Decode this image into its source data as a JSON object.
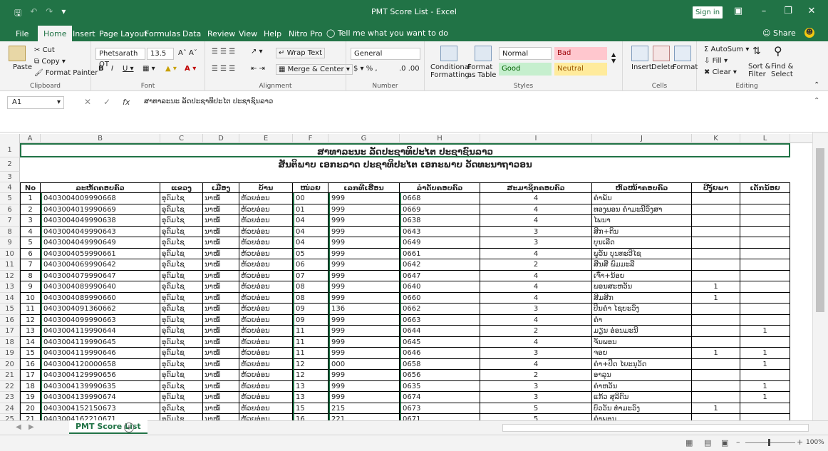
{
  "app": {
    "title": "PMT Score List  -  Excel",
    "signin": "Sign in",
    "share": "Share",
    "tell_me": "Tell me what you want to do"
  },
  "tabs": [
    "File",
    "Home",
    "Insert",
    "Page Layout",
    "Formulas",
    "Data",
    "Review",
    "View",
    "Help",
    "Nitro Pro"
  ],
  "ribbon": {
    "clipboard": {
      "paste": "Paste",
      "cut": "Cut",
      "copy": "Copy",
      "format_painter": "Format Painter",
      "label": "Clipboard"
    },
    "font": {
      "name": "Phetsarath OT",
      "size": "13.5",
      "label": "Font"
    },
    "alignment": {
      "wrap": "Wrap Text",
      "merge": "Merge & Center",
      "label": "Alignment"
    },
    "number": {
      "format": "General",
      "label": "Number"
    },
    "styles": {
      "conditional": "Conditional Formatting",
      "format_table": "Format as Table",
      "normal": "Normal",
      "bad": "Bad",
      "good": "Good",
      "neutral": "Neutral",
      "label": "Styles"
    },
    "cells": {
      "insert": "Insert",
      "delete": "Delete",
      "format": "Format",
      "label": "Cells"
    },
    "editing": {
      "autosum": "AutoSum",
      "fill": "Fill",
      "clear": "Clear",
      "sort": "Sort & Filter",
      "find": "Find & Select",
      "label": "Editing"
    }
  },
  "formula_bar": {
    "name_box": "A1",
    "fx": "fx",
    "value": "ສາທາລະນະ ລັດປະຊາທິປະໄຕ ປະຊາຊົນລາວ"
  },
  "columns": [
    "A",
    "B",
    "C",
    "D",
    "E",
    "F",
    "G",
    "H",
    "I",
    "J",
    "K",
    "L"
  ],
  "sheet": {
    "title1": "ສາທາລະນະ ລັດປະຊາທິປະໄຕ ປະຊາຊົນລາວ",
    "title2": "ສັນຕິພາບ ເອກະລາດ ປະຊາທິປະໄຕ ເອກະພາບ ວັດທະນາຖາວອນ",
    "headers": [
      "No",
      "ລະຫັດຄອບຄົວ",
      "ແຂວງ",
      "ເມືອງ",
      "ບ້ານ",
      "ໜ່ວຍ",
      "ເລກທີເຮືອນ",
      "ລຳດັບຄອບຄົວ",
      "ສະມາຊິກຄອບຄົວ",
      "ຫົວໜ້າຄອບຄົວ",
      "ປີງຸ້ຍພາ",
      "ເດັກນ້ອຍ"
    ],
    "rows": [
      [
        "1",
        "0403004009990668",
        "ອຸດົມໄຊ",
        "ນາໝໍ້",
        "ຫ້ວຍອ່ອນ",
        "00",
        "999",
        "0668",
        "4",
        "ຄຳພັນ",
        "",
        ""
      ],
      [
        "2",
        "0403004019990669",
        "ອຸດົມໄຊ",
        "ນາໝໍ້",
        "ຫ້ວຍອ່ອນ",
        "01",
        "999",
        "0669",
        "4",
        "ທອງພອນ ຄຳມະນີວົງສາ",
        "",
        ""
      ],
      [
        "3",
        "0403004049990638",
        "ອຸດົມໄຊ",
        "ນາໝໍ້",
        "ຫ້ວຍອ່ອນ",
        "04",
        "999",
        "0638",
        "4",
        "ໄພນາ",
        "",
        ""
      ],
      [
        "4",
        "0403004049990643",
        "ອຸດົມໄຊ",
        "ນາໝໍ້",
        "ຫ້ວຍອ່ອນ",
        "04",
        "999",
        "0643",
        "3",
        "ສີກ+ຕິນ",
        "",
        ""
      ],
      [
        "5",
        "0403004049990649",
        "ອຸດົມໄຊ",
        "ນາໝໍ້",
        "ຫ້ວຍອ່ອນ",
        "04",
        "999",
        "0649",
        "3",
        "ບຸນເລີດ",
        "",
        ""
      ],
      [
        "6",
        "0403004059990661",
        "ອຸດົມໄຊ",
        "ນາໝໍ້",
        "ຫ້ວຍອ່ອນ",
        "05",
        "999",
        "0661",
        "4",
        "ພູວັນ ບຸນທະວີໄຊ",
        "",
        ""
      ],
      [
        "7",
        "0403004069990642",
        "ອຸດົມໄຊ",
        "ນາໝໍ້",
        "ຫ້ວຍອ່ອນ",
        "06",
        "999",
        "0642",
        "2",
        "ສີນສີ ພົມມະລີ",
        "",
        ""
      ],
      [
        "8",
        "0403004079990647",
        "ອຸດົມໄຊ",
        "ນາໝໍ້",
        "ຫ້ວຍອ່ອນ",
        "07",
        "999",
        "0647",
        "4",
        "ເຈົ໋າ+ນ້ອຍ",
        "",
        ""
      ],
      [
        "9",
        "0403004089990640",
        "ອຸດົມໄຊ",
        "ນາໝໍ້",
        "ຫ້ວຍອ່ອນ",
        "08",
        "999",
        "0640",
        "4",
        "ພອນສະຫວັນ",
        "1",
        ""
      ],
      [
        "10",
        "0403004089990660",
        "ອຸດົມໄຊ",
        "ນາໝໍ້",
        "ຫ້ວຍອ່ອນ",
        "08",
        "999",
        "0660",
        "4",
        "ສີມສີກ",
        "1",
        ""
      ],
      [
        "11",
        "0403004091360662",
        "ອຸດົມໄຊ",
        "ນາໝໍ້",
        "ຫ້ວຍອ່ອນ",
        "09",
        "136",
        "0662",
        "3",
        "ປິນຄຳ ໄຊຍະວົງ",
        "",
        ""
      ],
      [
        "12",
        "0403004099990663",
        "ອຸດົມໄຊ",
        "ນາໝໍ້",
        "ຫ້ວຍອ່ອນ",
        "09",
        "999",
        "0663",
        "4",
        "ຄຳ",
        "",
        ""
      ],
      [
        "13",
        "0403004119990644",
        "ອຸດົມໄຊ",
        "ນາໝໍ້",
        "ຫ້ວຍອ່ອນ",
        "11",
        "999",
        "0644",
        "2",
        "ມຽນ ອ່ອນມະນີ",
        "",
        "1"
      ],
      [
        "14",
        "0403004119990645",
        "ອຸດົມໄຊ",
        "ນາໝໍ້",
        "ຫ້ວຍອ່ອນ",
        "11",
        "999",
        "0645",
        "4",
        "ຈັນພອນ",
        "",
        ""
      ],
      [
        "15",
        "0403004119990646",
        "ອຸດົມໄຊ",
        "ນາໝໍ້",
        "ຫ້ວຍອ່ອນ",
        "11",
        "999",
        "0646",
        "3",
        "ຈອຍ",
        "1",
        "1"
      ],
      [
        "16",
        "0403004120000658",
        "ອຸດົມໄຊ",
        "ນາໝໍ້",
        "ຫ້ວຍອ່ອນ",
        "12",
        "000",
        "0658",
        "4",
        "ຄຳ+ປິດ ໄຍະນຸວັດ",
        "",
        "1"
      ],
      [
        "17",
        "0403004129990656",
        "ອຸດົມໄຊ",
        "ນາໝໍ້",
        "ຫ້ວຍອ່ອນ",
        "12",
        "999",
        "0656",
        "2",
        "ອາລຸນ",
        "",
        ""
      ],
      [
        "18",
        "0403004139990635",
        "ອຸດົມໄຊ",
        "ນາໝໍ້",
        "ຫ້ວຍອ່ອນ",
        "13",
        "999",
        "0635",
        "3",
        "ຄຳຫວັນ",
        "",
        "1"
      ],
      [
        "19",
        "0403004139990674",
        "ອຸດົມໄຊ",
        "ນາໝໍ້",
        "ຫ້ວຍອ່ອນ",
        "13",
        "999",
        "0674",
        "3",
        "ແກ້ວ ສຸລິຕົນ",
        "",
        "1"
      ],
      [
        "20",
        "0403004152150673",
        "ອຸດົມໄຊ",
        "ນາໝໍ້",
        "ຫ້ວຍອ່ອນ",
        "15",
        "215",
        "0673",
        "5",
        "ບົວວັນ ທຳມະວົງ",
        "1",
        ""
      ],
      [
        "21",
        "0403004162210671",
        "ອຸດົມໄຊ",
        "ນາໝໍ້",
        "ຫ້ວຍອ່ອນ",
        "16",
        "221",
        "0671",
        "5",
        "ຄຳພອນ",
        "",
        ""
      ]
    ]
  },
  "sheet_tab": "PMT Score List",
  "zoom": "100%"
}
